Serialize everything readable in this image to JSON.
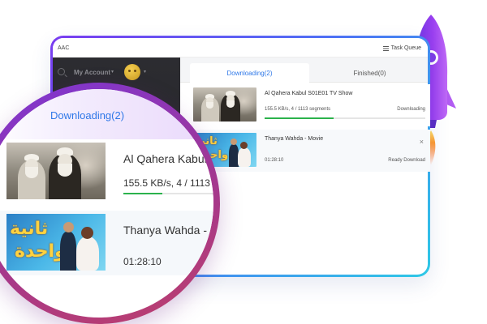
{
  "window": {
    "app_name": "AAC",
    "task_queue_label": "Task Queue"
  },
  "sidebar": {
    "account_label": "My Account",
    "account_arrow": "▾",
    "avatar_arrow": "▾"
  },
  "tabs": [
    {
      "label": "Downloading(2)",
      "active": true
    },
    {
      "label": "Finished(0)",
      "active": false
    }
  ],
  "downloads": [
    {
      "title": "Al Qahera Kabul S01E01 TV Show",
      "speed": "155.5 KB/s, 4 / 1113 segments",
      "status": "Downloading",
      "progress": 0.43
    },
    {
      "title": "Thanya Wahda - Movie",
      "duration": "01:28:10",
      "status": "Ready Download",
      "close_glyph": "×"
    }
  ],
  "magnifier": {
    "heading": "Downloading(2)",
    "item1_title": "Al Qahera Kabul",
    "item1_speed": "155.5 KB/s, 4 / 1113",
    "item1_progress": 0.43,
    "item2_title": "Thanya Wahda -",
    "item2_duration": "01:28:10"
  },
  "thumbnail_text": {
    "thanya_line1": "ثانية",
    "thanya_line2": "واحدة"
  },
  "colors": {
    "accent": "#2f78e8",
    "progress": "#2bb24c",
    "sidebar": "#2c2c31",
    "magnifier_ring": "#8e35b4"
  },
  "icons": [
    "list-icon",
    "search-icon",
    "close-icon",
    "rocket-icon",
    "avatar"
  ]
}
